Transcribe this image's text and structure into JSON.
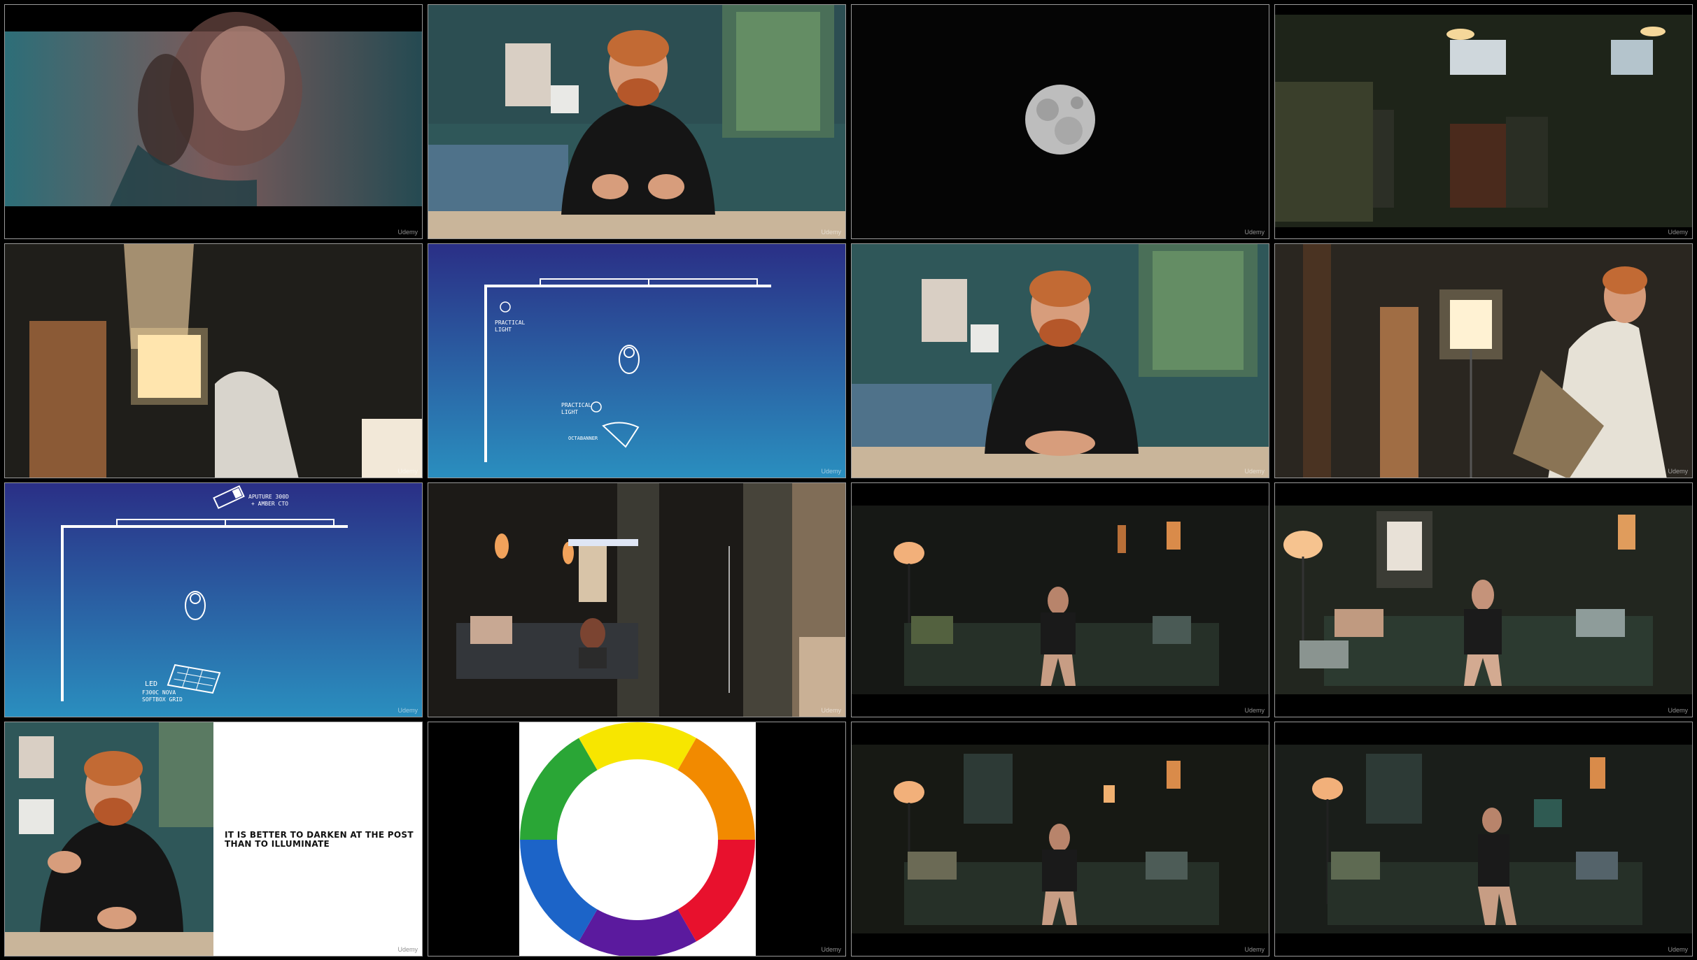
{
  "grid": {
    "columns": 4,
    "rows": 4,
    "colors": {
      "border": "#9a9a9a",
      "blue_top": "#2a2f86",
      "blue_bottom": "#2a8fbf"
    }
  },
  "watermark": "Udemy",
  "frames": [
    {
      "id": "r1c1",
      "scene": "woman-phone-teal"
    },
    {
      "id": "r1c2",
      "scene": "instructor-talking"
    },
    {
      "id": "r1c3",
      "scene": "moon"
    },
    {
      "id": "r1c4",
      "scene": "dark-interior"
    },
    {
      "id": "r2c1",
      "scene": "softbox-grid-setup"
    },
    {
      "id": "r2c2",
      "scene": "lighting-diagram-practical",
      "labels": {
        "practical_top": "PRACTICAL\nLIGHT",
        "practical_bottom": "PRACTICAL\nLIGHT",
        "modifier": "OCTABANNER"
      }
    },
    {
      "id": "r2c3",
      "scene": "instructor-hands-folded"
    },
    {
      "id": "r2c4",
      "scene": "led-panel-setup"
    },
    {
      "id": "r3c1",
      "scene": "lighting-diagram-led",
      "labels": {
        "top": "APUTURE 300D\n+ AMBER CTO",
        "bottom_led": "LED",
        "bottom_model": "F300C NOVA",
        "bottom_mod": "SOFTBOX GRID"
      }
    },
    {
      "id": "r3c2",
      "scene": "studio-setup-couch"
    },
    {
      "id": "r3c3",
      "scene": "couch-lamp-dark"
    },
    {
      "id": "r3c4",
      "scene": "couch-lamp-brighter"
    },
    {
      "id": "r4c1",
      "scene": "instructor-slide",
      "slide_text": "IT IS BETTER TO DARKEN AT THE POST THAN TO ILLUMINATE"
    },
    {
      "id": "r4c2",
      "scene": "color-wheel",
      "wheel_colors": [
        "#f7e600",
        "#f28a00",
        "#e8112d",
        "#5b1a9e",
        "#1c64c8",
        "#2aa636"
      ]
    },
    {
      "id": "r4c3",
      "scene": "couch-lamp-table"
    },
    {
      "id": "r4c4",
      "scene": "couch-lamp-reading"
    }
  ]
}
